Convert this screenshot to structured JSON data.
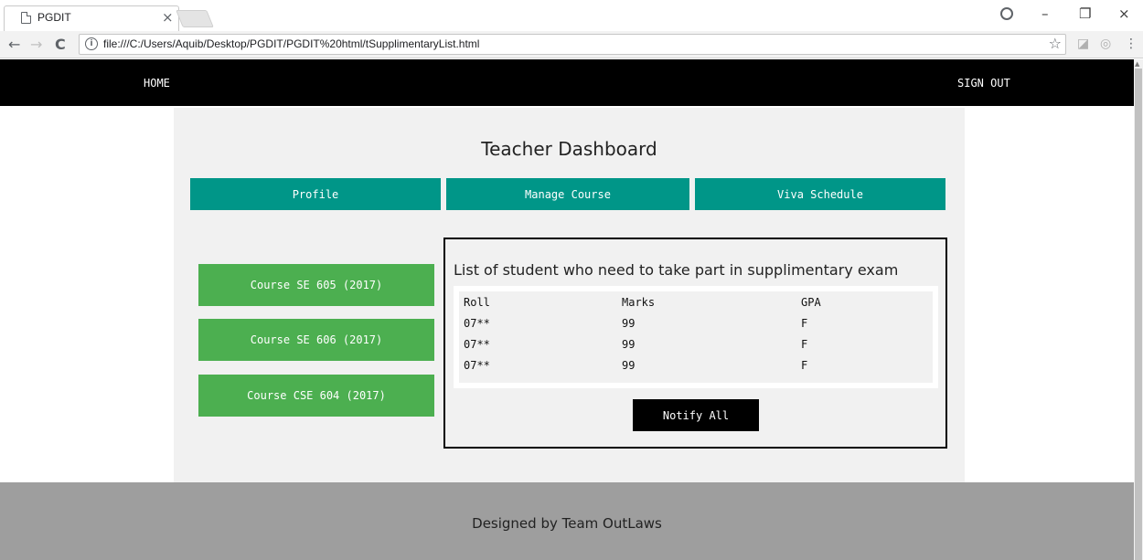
{
  "browser": {
    "tab_title": "PGDIT",
    "tab_close": "×",
    "url": "file:///C:/Users/Aquib/Desktop/PGDIT/PGDIT%20html/tSupplimentaryList.html",
    "info_icon": "i",
    "star": "☆",
    "back": "←",
    "forward": "→",
    "reload": "C",
    "win_minimize": "–",
    "win_restore": "❐",
    "win_close": "×"
  },
  "nav": {
    "home": "HOME",
    "sign_out": "SIGN OUT"
  },
  "dashboard": {
    "title": "Teacher Dashboard",
    "tabs": [
      "Profile",
      "Manage Course",
      "Viva Schedule"
    ]
  },
  "courses": [
    "Course SE 605 (2017)",
    "Course SE 606 (2017)",
    "Course CSE 604 (2017)"
  ],
  "supplementary": {
    "heading": "List of student who need to take part in supplimentary exam",
    "columns": [
      "Roll",
      "Marks",
      "GPA"
    ],
    "rows": [
      [
        "07**",
        "99",
        "F"
      ],
      [
        "07**",
        "99",
        "F"
      ],
      [
        "07**",
        "99",
        "F"
      ]
    ],
    "notify_label": "Notify All"
  },
  "footer": {
    "text": "Designed by Team OutLaws"
  },
  "colors": {
    "nav_bg": "#000000",
    "tab_bg": "#009688",
    "course_bg": "#4caf50",
    "panel_bg": "#f1f1f1",
    "footer_bg": "#9e9e9e"
  }
}
